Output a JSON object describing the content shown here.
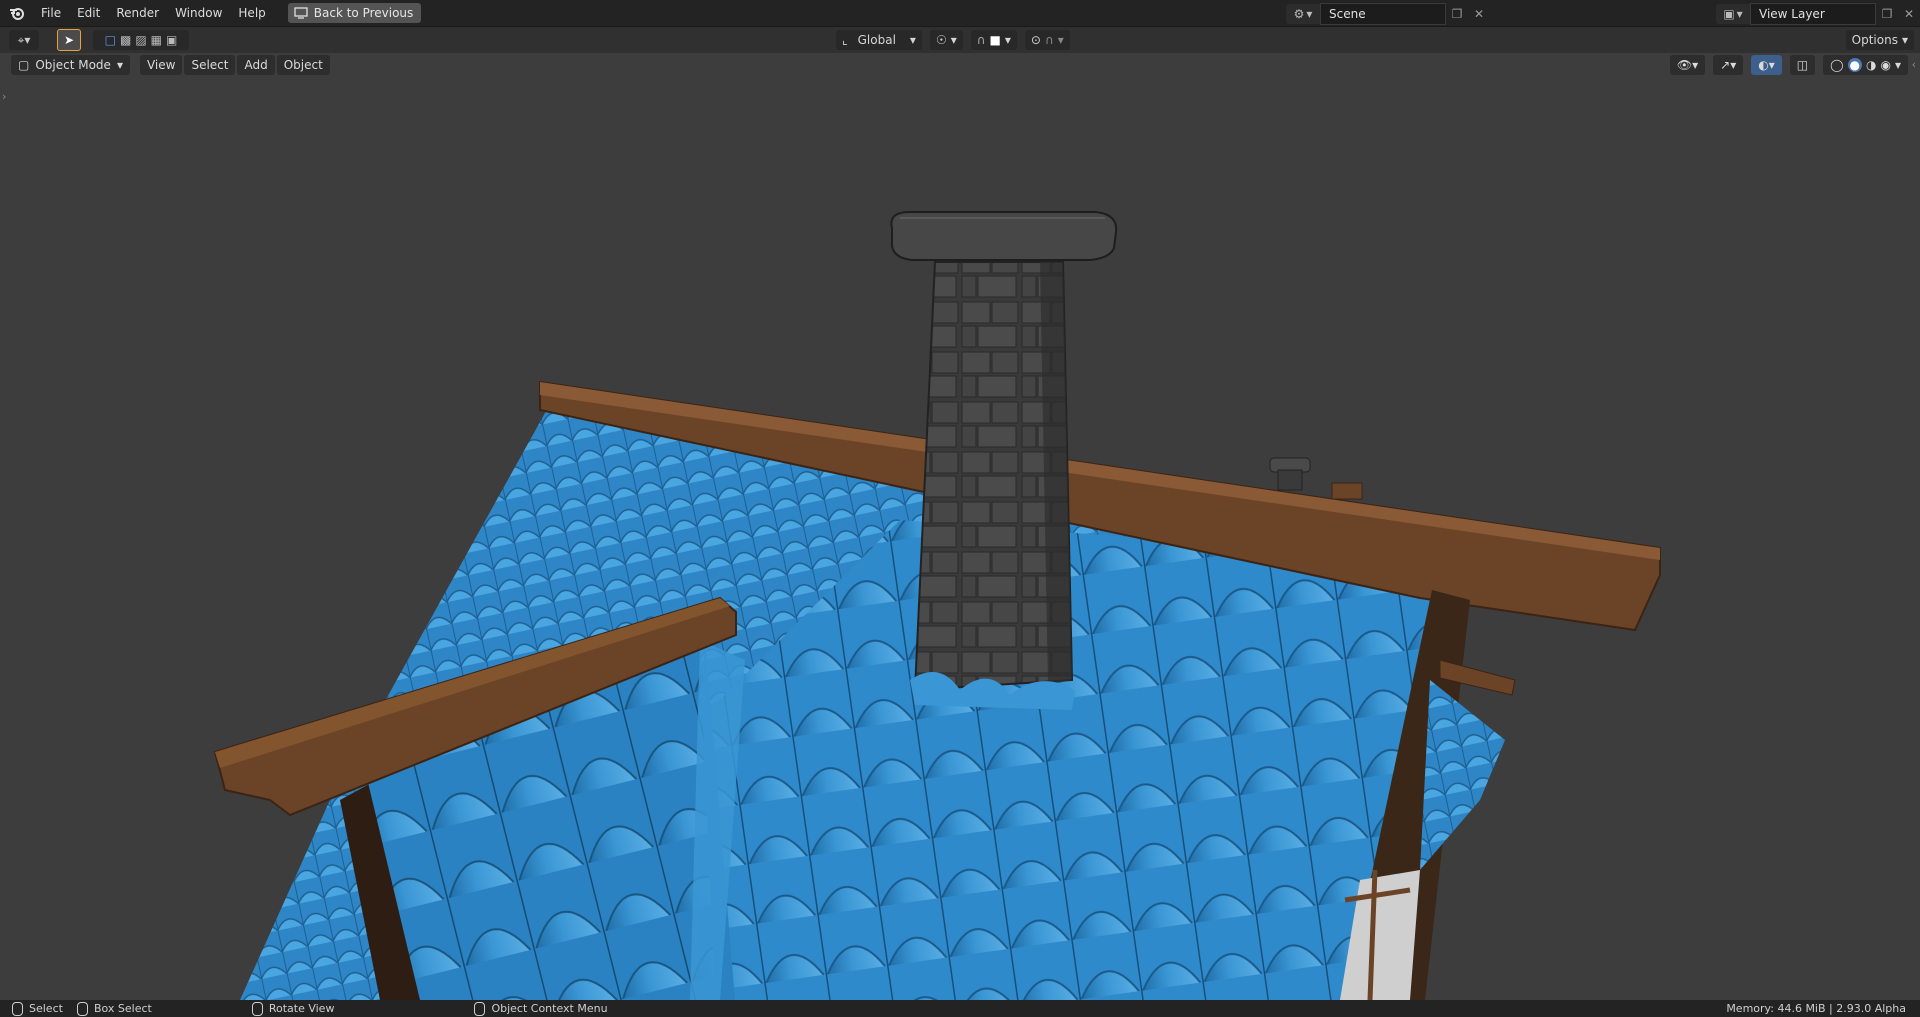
{
  "menu": {
    "items": [
      "File",
      "Edit",
      "Render",
      "Window",
      "Help"
    ],
    "back_button": "Back to Previous"
  },
  "scene": {
    "name": "Scene"
  },
  "view_layer": {
    "name": "View Layer"
  },
  "tool_header": {
    "transform_orientation": "Global",
    "options_label": "Options"
  },
  "view_header": {
    "mode": "Object Mode",
    "menus": [
      "View",
      "Select",
      "Add",
      "Object"
    ]
  },
  "status": {
    "select": "Select",
    "box_select": "Box Select",
    "rotate_view": "Rotate View",
    "context_menu": "Object Context Menu",
    "memory": "Memory: 44.6 MiB | 2.93.0 Alpha"
  },
  "colors": {
    "roof_tile": "#3a96d4",
    "roof_tile_dark": "#1f6ea8",
    "wood_beam": "#6b4428",
    "chimney": "#444444",
    "accent": "#e6a33a",
    "background": "#3d3d3d"
  }
}
